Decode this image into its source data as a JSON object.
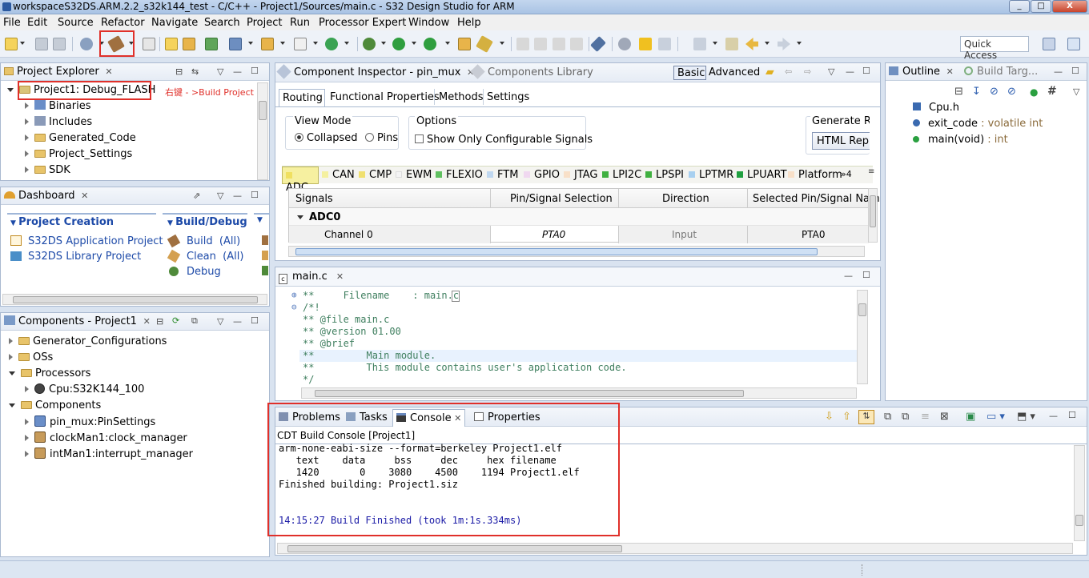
{
  "window": {
    "title": "workspaceS32DS.ARM.2.2_s32k144_test - C/C++ - Project1/Sources/main.c - S32 Design Studio for ARM",
    "btn_min": "_",
    "btn_max": "□",
    "btn_close": "X"
  },
  "menu": [
    "File",
    "Edit",
    "Source",
    "Refactor",
    "Navigate",
    "Search",
    "Project",
    "Run",
    "Processor Expert",
    "Window",
    "Help"
  ],
  "quick_access": "Quick Access",
  "project_explorer": {
    "tab": "Project Explorer",
    "root": "Project1: Debug_FLASH",
    "annotation": "右键 - >Build Project",
    "items": [
      "Binaries",
      "Includes",
      "Generated_Code",
      "Project_Settings",
      "SDK"
    ]
  },
  "dashboard": {
    "tab": "Dashboard",
    "project_creation": "Project Creation",
    "build_debug": "Build/Debug",
    "links": [
      "S32DS Application Project",
      "S32DS Library Project"
    ],
    "build": "Build",
    "build_all": "(All)",
    "clean": "Clean",
    "clean_all": "(All)",
    "debug": "Debug"
  },
  "components": {
    "tab": "Components - Project1",
    "items": [
      "Generator_Configurations",
      "OSs",
      "Processors",
      "Cpu:S32K144_100",
      "Components",
      "pin_mux:PinSettings",
      "clockMan1:clock_manager",
      "intMan1:interrupt_manager"
    ]
  },
  "inspector": {
    "tab": "Component Inspector - pin_mux",
    "tab2": "Components Library",
    "basic": "Basic",
    "advanced": "Advanced",
    "subtabs": [
      "Routing",
      "Functional Properties",
      "Methods",
      "Settings"
    ],
    "view_mode": "View Mode",
    "collapsed": "Collapsed",
    "pins": "Pins",
    "options": "Options",
    "show_only": "Show Only Configurable Signals",
    "generate_re": "Generate Re",
    "html_rep": "HTML Rep",
    "peripherals": [
      "ADC",
      "CAN",
      "CMP",
      "EWM",
      "FLEXIO",
      "FTM",
      "GPIO",
      "JTAG",
      "LPI2C",
      "LPSPI",
      "LPTMR",
      "LPUART",
      "Platform"
    ],
    "more": "»4",
    "columns": [
      "Signals",
      "Pin/Signal Selection",
      "Direction",
      "Selected Pin/Signal Nam"
    ],
    "group": "ADC0",
    "row": {
      "signal": "Channel 0",
      "pin": "PTA0",
      "direction": "Input",
      "selected": "PTA0"
    }
  },
  "editor": {
    "tab": "main.c",
    "lines": [
      {
        "gutter": "⊕",
        "text": "**     Filename    : main.c"
      },
      {
        "gutter": "⊖",
        "text": "/*!"
      },
      {
        "gutter": "",
        "text": "** @file main.c"
      },
      {
        "gutter": "",
        "text": "** @version 01.00"
      },
      {
        "gutter": "",
        "text": "** @brief"
      },
      {
        "gutter": "",
        "text": "**         Main module."
      },
      {
        "gutter": "",
        "text": "**         This module contains user's application code."
      },
      {
        "gutter": "",
        "text": "*/"
      }
    ]
  },
  "outline": {
    "tab": "Outline",
    "tab2": "Build Targ...",
    "items": [
      {
        "name": "Cpu.h",
        "type": ""
      },
      {
        "name": "exit_code",
        "type": " : volatile int"
      },
      {
        "name": "main(void)",
        "type": " : int"
      }
    ]
  },
  "console": {
    "tabs": [
      "Problems",
      "Tasks",
      "Console",
      "Properties"
    ],
    "header": "CDT Build Console [Project1]",
    "lines": [
      "arm-none-eabi-size --format=berkeley Project1.elf",
      "   text    data     bss     dec     hex filename",
      "   1420       0    3080    4500    1194 Project1.elf",
      "Finished building: Project1.siz"
    ],
    "finished": "14:15:27 Build Finished (took 1m:1s.334ms)"
  },
  "colors": {
    "highlight_red": "#e0302a",
    "link_blue": "#1d4aa8",
    "console_blue": "#1a1aa6"
  }
}
